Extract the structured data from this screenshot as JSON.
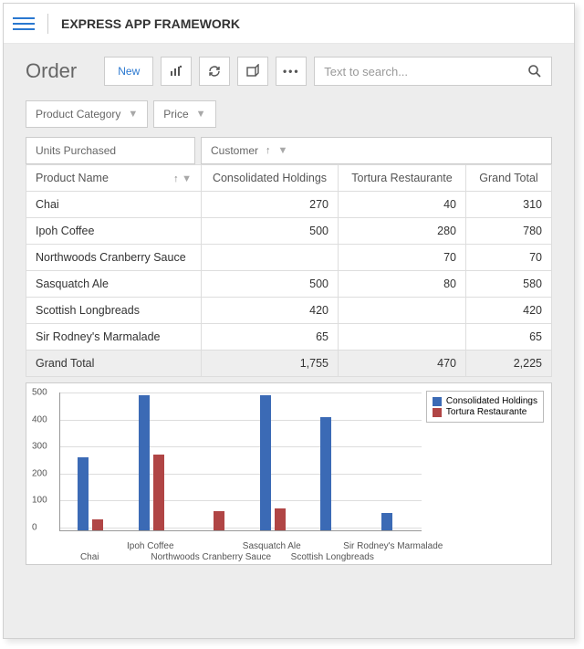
{
  "header": {
    "app_title": "EXPRESS APP FRAMEWORK"
  },
  "toolbar": {
    "page_title": "Order",
    "new_label": "New",
    "search_placeholder": "Text to search..."
  },
  "filters": {
    "product_category": "Product Category",
    "price": "Price"
  },
  "pivot": {
    "row_area_title": "Units Purchased",
    "col_area_title": "Customer",
    "row_field": "Product Name",
    "grand_total_label": "Grand Total",
    "columns": [
      "Consolidated Holdings",
      "Tortura Restaurante"
    ],
    "rows": [
      {
        "name": "Chai",
        "values": [
          "270",
          "40"
        ],
        "total": "310"
      },
      {
        "name": "Ipoh Coffee",
        "values": [
          "500",
          "280"
        ],
        "total": "780"
      },
      {
        "name": "Northwoods Cranberry Sauce",
        "values": [
          "",
          "70"
        ],
        "total": "70"
      },
      {
        "name": "Sasquatch Ale",
        "values": [
          "500",
          "80"
        ],
        "total": "580"
      },
      {
        "name": "Scottish Longbreads",
        "values": [
          "420",
          ""
        ],
        "total": "420"
      },
      {
        "name": "Sir Rodney's Marmalade",
        "values": [
          "65",
          ""
        ],
        "total": "65"
      }
    ],
    "totals": {
      "label": "Grand Total",
      "values": [
        "1,755",
        "470"
      ],
      "grand": "2,225"
    }
  },
  "chart_data": {
    "type": "bar",
    "categories": [
      "Chai",
      "Ipoh Coffee",
      "Northwoods Cranberry Sauce",
      "Sasquatch Ale",
      "Scottish Longbreads",
      "Sir Rodney's Marmalade"
    ],
    "series": [
      {
        "name": "Consolidated Holdings",
        "color": "#3b6ab5",
        "values": [
          270,
          500,
          0,
          500,
          420,
          65
        ]
      },
      {
        "name": "Tortura Restaurante",
        "color": "#b04545",
        "values": [
          40,
          280,
          70,
          80,
          0,
          0
        ]
      }
    ],
    "ylim": [
      0,
      500
    ],
    "ystep": 100,
    "xlabel": "",
    "ylabel": ""
  }
}
